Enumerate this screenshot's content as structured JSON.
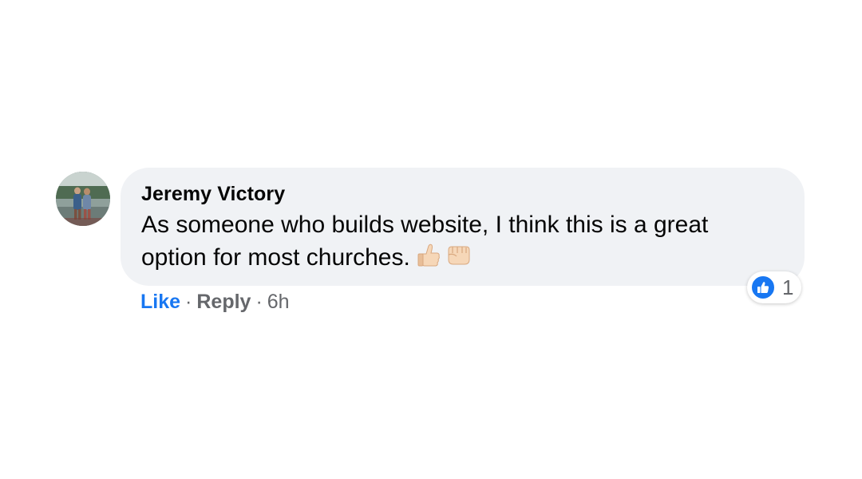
{
  "comment": {
    "author": "Jeremy Victory",
    "line1": "As someone who builds website, I think this is a great",
    "line2": "option for most churches.",
    "emojis": [
      "thumbs-up-icon",
      "fist-bump-icon"
    ]
  },
  "reactions": {
    "icon": "like-icon",
    "count": "1"
  },
  "actions": {
    "like_label": "Like",
    "separator": "·",
    "reply_label": "Reply",
    "timestamp": "6h"
  },
  "colors": {
    "bubble": "#f0f2f5",
    "like_blue": "#1877f2",
    "meta_gray": "#65676b",
    "text": "#050505"
  }
}
